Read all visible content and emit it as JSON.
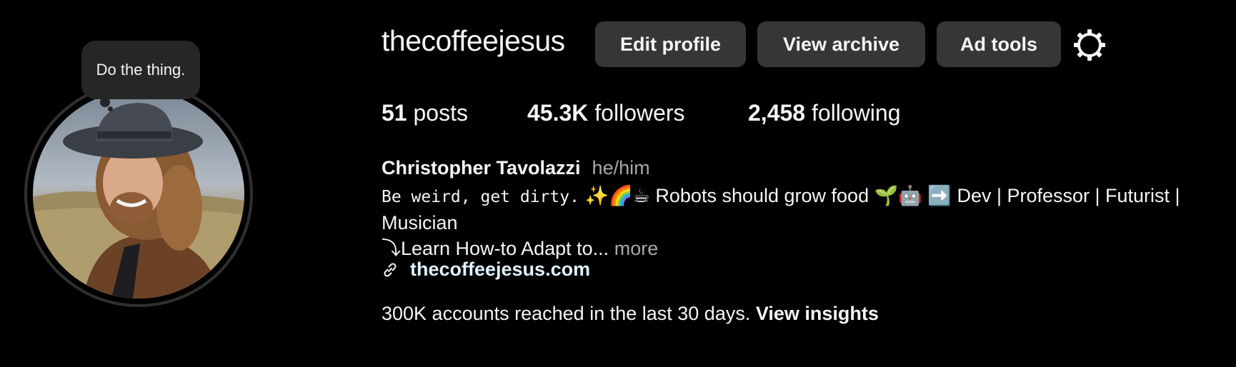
{
  "profile": {
    "username": "thecoffeejesus",
    "note": "Do the thing.",
    "full_name": "Christopher Tavolazzi",
    "pronouns": "he/him"
  },
  "actions": {
    "edit_profile": "Edit profile",
    "view_archive": "View archive",
    "ad_tools": "Ad tools",
    "settings_icon": "gear-icon"
  },
  "stats": {
    "posts_count": "51",
    "posts_label": "posts",
    "followers_count": "45.3K",
    "followers_label": "followers",
    "following_count": "2,458",
    "following_label": "following"
  },
  "bio": {
    "mono_part": "Be weird, get dirty.",
    "rest_part": " ✨🌈☕ Robots should grow food 🌱🤖 ➡️ Dev | Professor | Futurist | Musician",
    "line3": "⤵Learn How-to Adapt to...",
    "more": "more",
    "link_icon": "link-icon",
    "link": "thecoffeejesus.com"
  },
  "insights": {
    "text": "300K accounts reached in the last 30 days.",
    "link": "View insights"
  },
  "colors": {
    "background": "#000000",
    "button": "#363636",
    "muted": "#a8a8a8",
    "link": "#e0f1ff"
  }
}
